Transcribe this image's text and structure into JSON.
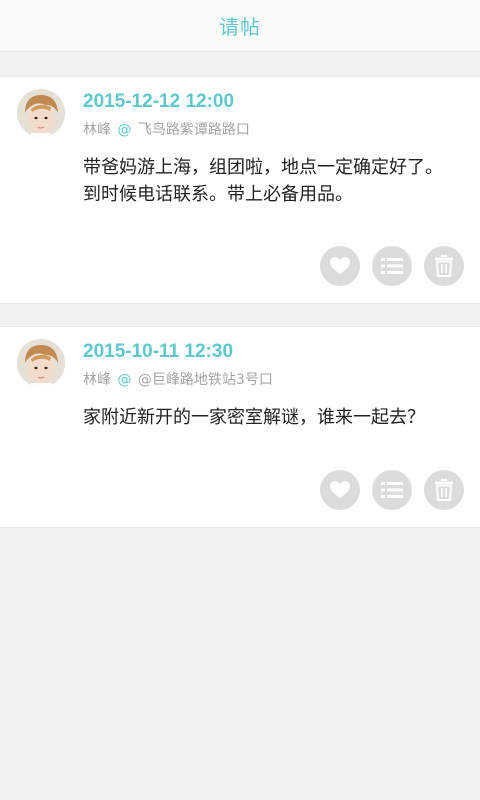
{
  "header": {
    "title": "请帖"
  },
  "posts": [
    {
      "time": "2015-12-12 12:00",
      "author": "林峰",
      "at": "@",
      "location": "飞鸟路紫谭路路口",
      "lines": [
        "带爸妈游上海，组团啦，地点一定确定好了。",
        "到时候电话联系。带上必备用品。"
      ],
      "actions": [
        "heart-icon",
        "list-icon",
        "trash-icon"
      ]
    },
    {
      "time": "2015-10-11 12:30",
      "author": "林峰",
      "at": "@",
      "location": "@巨峰路地铁站3号口",
      "lines": [
        "家附近新开的一家密室解谜，谁来一起去？"
      ],
      "actions": [
        "heart-icon",
        "list-icon",
        "trash-icon"
      ]
    }
  ],
  "colors": {
    "accent": "#5ec8cc",
    "background": "#f2f2f2",
    "card": "#ffffff",
    "meta_text": "#a4a4a4",
    "body_text": "#222222",
    "action_bg": "#dcdcdc"
  }
}
